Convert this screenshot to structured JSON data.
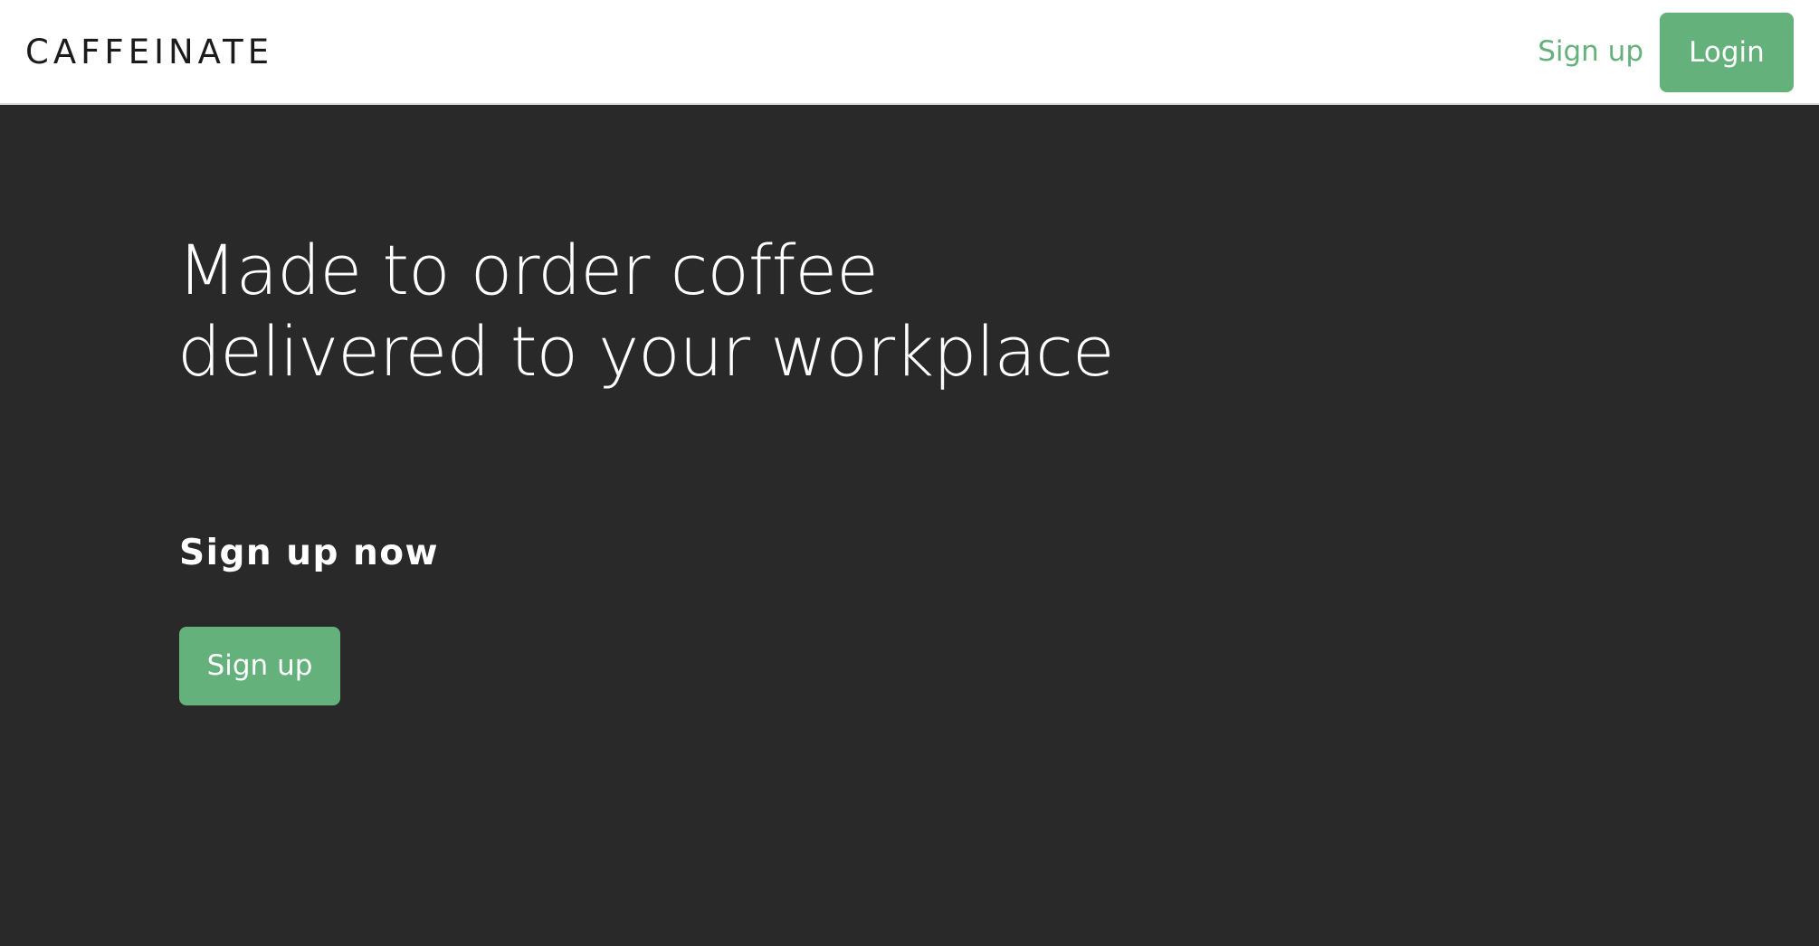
{
  "colors": {
    "accent": "#64b17b",
    "hero_background": "#292929",
    "navbar_background": "#ffffff"
  },
  "navbar": {
    "brand": "CAFFEINATE",
    "signup_label": "Sign up",
    "login_label": "Login"
  },
  "hero": {
    "headline_line1": "Made to order coffee",
    "headline_line2": "delivered to your workplace",
    "subheading": "Sign up now",
    "signup_label": "Sign up"
  }
}
